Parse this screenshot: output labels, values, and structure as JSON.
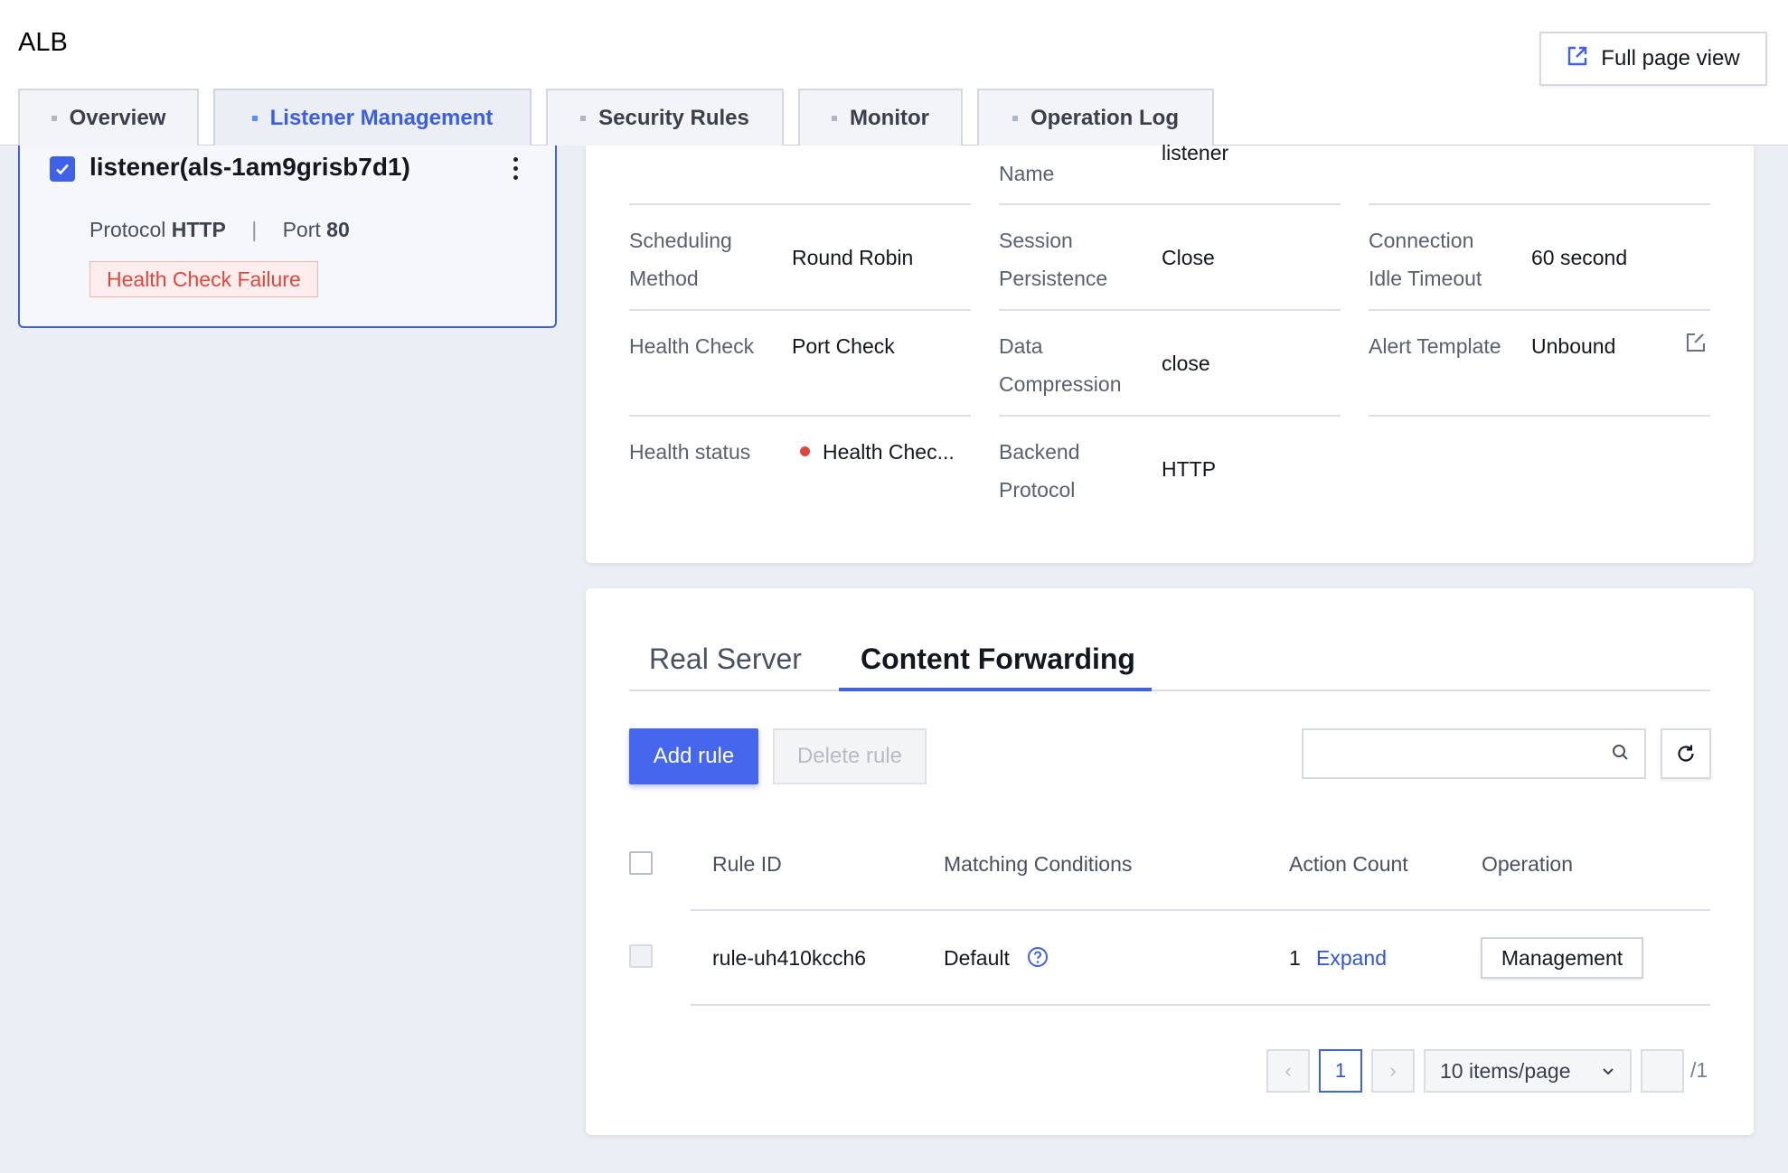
{
  "app": {
    "title": "ALB",
    "full_page_label": "Full page view"
  },
  "tabs": [
    "Overview",
    "Listener Management",
    "Security Rules",
    "Monitor",
    "Operation Log"
  ],
  "listener": {
    "name": "listener(als-1am9grisb7d1)",
    "protocol_label": "Protocol",
    "protocol": "HTTP",
    "separator": "|",
    "port_label": "Port",
    "port": "80",
    "status": "Health Check Failure"
  },
  "details": {
    "name_label": "Name",
    "name_value": "listener",
    "scheduling_label_1": "Scheduling",
    "scheduling_label_2": "Method",
    "scheduling_value": "Round Robin",
    "session_label_1": "Session",
    "session_label_2": "Persistence",
    "session_value": "Close",
    "idle_label_1": "Connection",
    "idle_label_2": "Idle Timeout",
    "idle_value": "60 second",
    "health_check_label": "Health Check",
    "health_check_value": "Port Check",
    "compression_label_1": "Data",
    "compression_label_2": "Compression",
    "compression_value": "close",
    "alert_label": "Alert Template",
    "alert_value": "Unbound",
    "health_status_label": "Health status",
    "health_status_value": "Health Chec...",
    "backend_label_1": "Backend",
    "backend_label_2": "Protocol",
    "backend_value": "HTTP"
  },
  "rules": {
    "subtabs": [
      "Real Server",
      "Content Forwarding"
    ],
    "add_label": "Add rule",
    "delete_label": "Delete rule",
    "search_placeholder": "",
    "columns": [
      "Rule ID",
      "Matching Conditions",
      "Action Count",
      "Operation"
    ],
    "rows": [
      {
        "rule_id": "rule-uh410kcch6",
        "condition": "Default",
        "action_count": "1",
        "expand": "Expand",
        "operation": "Management"
      }
    ],
    "pagination": {
      "prev": "‹",
      "page": "1",
      "next": "›",
      "size_label": "10 items/page",
      "total": "/1"
    }
  },
  "colors": {
    "accent": "#4567ee",
    "danger": "#e0463b",
    "link": "#2f55d4"
  }
}
